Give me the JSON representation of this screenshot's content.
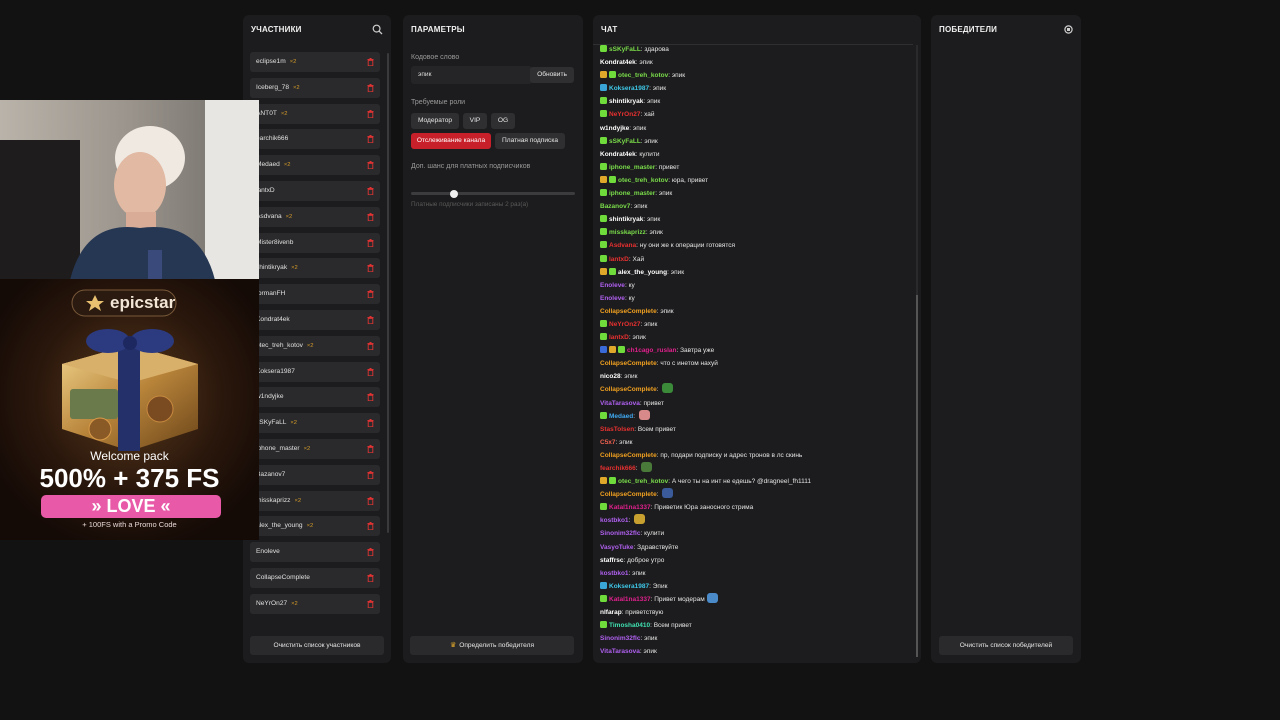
{
  "participants": {
    "title": "УЧАСТНИКИ",
    "search_icon": "search-icon",
    "clear_button": "Очистить список участников",
    "items": [
      {
        "name": "eclipse1m",
        "badge": "×2"
      },
      {
        "name": "Iceberg_78",
        "badge": "×2"
      },
      {
        "name": "ANT0T",
        "badge": "×2"
      },
      {
        "name": "earchik666",
        "badge": ""
      },
      {
        "name": "Medaed",
        "badge": "×2"
      },
      {
        "name": "lantxD",
        "badge": ""
      },
      {
        "name": "Asdvana",
        "badge": "×2"
      },
      {
        "name": "Mister8ivenb",
        "badge": ""
      },
      {
        "name": "shintikryak",
        "badge": "×2"
      },
      {
        "name": "formanFH",
        "badge": ""
      },
      {
        "name": "Kondrat4ek",
        "badge": ""
      },
      {
        "name": "otec_treh_kotov",
        "badge": "×2"
      },
      {
        "name": "Koksera1987",
        "badge": ""
      },
      {
        "name": "w1ndyjke",
        "badge": ""
      },
      {
        "name": "sSKyFaLL",
        "badge": "×2"
      },
      {
        "name": "iphone_master",
        "badge": "×2"
      },
      {
        "name": "Bazanov7",
        "badge": ""
      },
      {
        "name": "misskaprizz",
        "badge": "×2"
      },
      {
        "name": "alex_the_young",
        "badge": "×2"
      },
      {
        "name": "Enoleve",
        "badge": ""
      },
      {
        "name": "CollapseComplete",
        "badge": ""
      },
      {
        "name": "NeYrOn27",
        "badge": "×2"
      }
    ]
  },
  "params": {
    "title": "ПАРАМЕТРЫ",
    "codeword_label": "Кодовое слово",
    "codeword_value": "эпик",
    "update_button": "Обновить",
    "roles_label": "Требуемые роли",
    "roles": [
      "Модератор",
      "VIP",
      "OG"
    ],
    "track_button": "Отслеживание канала",
    "paid_button": "Платная подписка",
    "bonus_label": "Доп. шанс для платных подписчиков",
    "bonus_level": 0.26,
    "bonus_note": "Платные подписчики записаны 2 раз(а)",
    "winner_button": "Определить победителя",
    "crown_icon": "crown-icon"
  },
  "chat": {
    "title": "ЧАТ",
    "messages": [
      {
        "icons": [
          "#6fdc3c"
        ],
        "nick": "sSKyFaLL",
        "color": "#7adc4a",
        "text": "здарова",
        "emote": ""
      },
      {
        "icons": [],
        "nick": "Kondrat4ek",
        "color": "#ffffff",
        "text": "эпик",
        "emote": ""
      },
      {
        "icons": [
          "#e0a82a",
          "#6fdc3c"
        ],
        "nick": "otec_treh_kotov",
        "color": "#7adc4a",
        "text": "эпик",
        "emote": ""
      },
      {
        "icons": [
          "#3aa6d8"
        ],
        "nick": "Koksera1987",
        "color": "#3fc8e8",
        "text": "эпик",
        "emote": ""
      },
      {
        "icons": [
          "#6fdc3c"
        ],
        "nick": "shintikryak",
        "color": "#ffffff",
        "text": "эпик",
        "emote": ""
      },
      {
        "icons": [
          "#6fdc3c"
        ],
        "nick": "NeYrOn27",
        "color": "#e83030",
        "text": "хай",
        "emote": ""
      },
      {
        "icons": [],
        "nick": "w1ndyjke",
        "color": "#ffffff",
        "text": "эпик",
        "emote": ""
      },
      {
        "icons": [
          "#6fdc3c"
        ],
        "nick": "sSKyFaLL",
        "color": "#7adc4a",
        "text": "эпик",
        "emote": ""
      },
      {
        "icons": [],
        "nick": "Kondrat4ek",
        "color": "#ffffff",
        "text": "кулити",
        "emote": ""
      },
      {
        "icons": [
          "#6fdc3c"
        ],
        "nick": "iphone_master",
        "color": "#7adc4a",
        "text": "привет",
        "emote": ""
      },
      {
        "icons": [
          "#e0a82a",
          "#6fdc3c"
        ],
        "nick": "otec_treh_kotov",
        "color": "#7adc4a",
        "text": "юра, привет",
        "emote": ""
      },
      {
        "icons": [
          "#6fdc3c"
        ],
        "nick": "iphone_master",
        "color": "#7adc4a",
        "text": "эпик",
        "emote": ""
      },
      {
        "icons": [],
        "nick": "Bazanov7",
        "color": "#7adc4a",
        "text": "эпик",
        "emote": ""
      },
      {
        "icons": [
          "#6fdc3c"
        ],
        "nick": "shintikryak",
        "color": "#ffffff",
        "text": "эпик",
        "emote": ""
      },
      {
        "icons": [
          "#6fdc3c"
        ],
        "nick": "misskaprizz",
        "color": "#7adc4a",
        "text": "эпик",
        "emote": ""
      },
      {
        "icons": [
          "#6fdc3c"
        ],
        "nick": "Asdvana",
        "color": "#e83030",
        "text": "ну они же к операции готовятся",
        "emote": ""
      },
      {
        "icons": [
          "#6fdc3c"
        ],
        "nick": "lantxD",
        "color": "#e83030",
        "text": "Хай",
        "emote": ""
      },
      {
        "icons": [
          "#e0a82a",
          "#6fdc3c"
        ],
        "nick": "alex_the_young",
        "color": "#ffffff",
        "text": "эпик",
        "emote": ""
      },
      {
        "icons": [],
        "nick": "Enoleve",
        "color": "#b060f0",
        "text": "ку",
        "emote": ""
      },
      {
        "icons": [],
        "nick": "Enoleve",
        "color": "#b060f0",
        "text": "ку",
        "emote": ""
      },
      {
        "icons": [],
        "nick": "CollapseComplete",
        "color": "#f0a020",
        "text": "эпик",
        "emote": ""
      },
      {
        "icons": [
          "#6fdc3c"
        ],
        "nick": "NeYrOn27",
        "color": "#e83030",
        "text": "эпик",
        "emote": ""
      },
      {
        "icons": [
          "#6fdc3c"
        ],
        "nick": "lantxD",
        "color": "#e83030",
        "text": "эпик",
        "emote": ""
      },
      {
        "icons": [
          "#3a6ad8",
          "#e0a82a",
          "#6fdc3c"
        ],
        "nick": "ch1cago_ruslan",
        "color": "#e0208c",
        "text": "Завтра уже",
        "emote": ""
      },
      {
        "icons": [],
        "nick": "CollapseComplete",
        "color": "#f0a020",
        "text": "что с инетом нахуй",
        "emote": ""
      },
      {
        "icons": [],
        "nick": "nico28",
        "color": "#ffffff",
        "text": "эпик",
        "emote": ""
      },
      {
        "icons": [],
        "nick": "CollapseComplete",
        "color": "#f0a020",
        "text": "",
        "emote": "#3a8a3a"
      },
      {
        "icons": [],
        "nick": "VitaTarasova",
        "color": "#b060f0",
        "text": "привет",
        "emote": ""
      },
      {
        "icons": [
          "#6fdc3c"
        ],
        "nick": "Medaed",
        "color": "#3fa8f0",
        "text": "",
        "emote": "#d88a8a"
      },
      {
        "icons": [],
        "nick": "StasTolsen",
        "color": "#e83030",
        "text": "Всем привет",
        "emote": ""
      },
      {
        "icons": [],
        "nick": "C5x7",
        "color": "#f06050",
        "text": "эпик",
        "emote": ""
      },
      {
        "icons": [],
        "nick": "CollapseComplete",
        "color": "#f0a020",
        "text": "пр, подари подписку и адрес тронов в лс скинь",
        "emote": ""
      },
      {
        "icons": [],
        "nick": "fearchik666",
        "color": "#e83030",
        "text": "",
        "emote": "#4a7a3a"
      },
      {
        "icons": [
          "#e0a82a",
          "#6fdc3c"
        ],
        "nick": "otec_treh_kotov",
        "color": "#7adc4a",
        "text": "А чего ты на инт не едешь? @dragneel_fh1111",
        "emote": ""
      },
      {
        "icons": [],
        "nick": "CollapseComplete",
        "color": "#f0a020",
        "text": "",
        "emote": "#3a5a9a"
      },
      {
        "icons": [
          "#6fdc3c"
        ],
        "nick": "Katal1na1337",
        "color": "#e0208c",
        "text": "Приветик Юра заносного стрима",
        "emote": ""
      },
      {
        "icons": [],
        "nick": "kostbko1",
        "color": "#b060f0",
        "text": "",
        "emote": "#c8a030"
      },
      {
        "icons": [],
        "nick": "Sinonim32flc",
        "color": "#b060f0",
        "text": "кулити",
        "emote": ""
      },
      {
        "icons": [],
        "nick": "VasyoTuke",
        "color": "#b060f0",
        "text": "Здравствуйте",
        "emote": ""
      },
      {
        "icons": [],
        "nick": "staffrsc",
        "color": "#ffffff",
        "text": "доброе утро",
        "emote": ""
      },
      {
        "icons": [],
        "nick": "kostbko1",
        "color": "#b060f0",
        "text": "эпик",
        "emote": ""
      },
      {
        "icons": [
          "#3aa6d8"
        ],
        "nick": "Koksera1987",
        "color": "#3fc8e8",
        "text": "Эпик",
        "emote": ""
      },
      {
        "icons": [
          "#6fdc3c"
        ],
        "nick": "Katal1na1337",
        "color": "#e0208c",
        "text": "Привет модерам",
        "emote": "#4a8ac8"
      },
      {
        "icons": [],
        "nick": "nlfarap",
        "color": "#ffffff",
        "text": "приветствую",
        "emote": ""
      },
      {
        "icons": [
          "#6fdc3c"
        ],
        "nick": "Timosha0410",
        "color": "#3fe0b0",
        "text": "Всем привет",
        "emote": ""
      },
      {
        "icons": [],
        "nick": "Sinonim32flc",
        "color": "#b060f0",
        "text": "эпик",
        "emote": ""
      },
      {
        "icons": [],
        "nick": "VitaTarasova",
        "color": "#b060f0",
        "text": "эпик",
        "emote": ""
      }
    ]
  },
  "winners": {
    "title": "ПОБЕДИТЕЛИ",
    "reset_icon": "refresh-icon",
    "clear_button": "Очистить список победителей"
  },
  "ad": {
    "brand": "epicstar",
    "headline": "Welcome pack",
    "offer": "500% + 375 FS",
    "code": "» LOVE «",
    "footnote": "+ 100FS with a Promo Code"
  },
  "colors": {
    "accent_red": "#c8202a",
    "badge_gold": "#d39a2a",
    "panel_bg": "#1c1c1e",
    "page_bg": "#121212"
  }
}
